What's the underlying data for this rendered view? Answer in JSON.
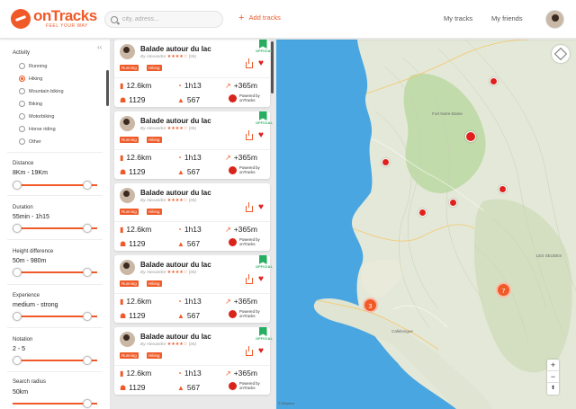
{
  "header": {
    "logo_name": "onTracks",
    "logo_tagline": "FEEL YOUR WAY",
    "search_placeholder": "city, adress...",
    "add_tracks": "Add tracks",
    "my_tracks": "My tracks",
    "my_friends": "My friends"
  },
  "filters": {
    "activity_label": "Activity",
    "activities": [
      {
        "label": "Running",
        "selected": false
      },
      {
        "label": "Hiking",
        "selected": true
      },
      {
        "label": "Mountain biking",
        "selected": false
      },
      {
        "label": "Biking",
        "selected": false
      },
      {
        "label": "Motorbiking",
        "selected": false
      },
      {
        "label": "Horse riding",
        "selected": false
      },
      {
        "label": "Other",
        "selected": false
      }
    ],
    "distance": {
      "label": "Distance",
      "value": "8Km - 19Km"
    },
    "duration": {
      "label": "Duration",
      "value": "55min - 1h15"
    },
    "height": {
      "label": "Height difference",
      "value": "50m - 980m"
    },
    "experience": {
      "label": "Experience",
      "value": "medium - strong"
    },
    "notation": {
      "label": "Notation",
      "value": "2 - 5"
    },
    "radius": {
      "label": "Search radius",
      "value": "50km"
    }
  },
  "tracks": [
    {
      "title": "Balade autour du lac",
      "by": "By Alexandre",
      "stars": "★★★★☆",
      "count": "(36)",
      "tags": [
        "Running",
        "Hiking"
      ],
      "distance": "12.6km",
      "duration": "1h13",
      "elevation": "+365m",
      "views": "1129",
      "likes": "567",
      "powered": "Powered by onTracks",
      "official": "OFFICIAL"
    },
    {
      "title": "Balade autour du lac",
      "by": "By Alexandre",
      "stars": "★★★★☆",
      "count": "(36)",
      "tags": [
        "Running",
        "Hiking"
      ],
      "distance": "12.6km",
      "duration": "1h13",
      "elevation": "+365m",
      "views": "1129",
      "likes": "567",
      "powered": "Powered by onTracks",
      "official": "OFFICIAL"
    },
    {
      "title": "Balade autour du lac",
      "by": "By Alexandre",
      "stars": "★★★★☆",
      "count": "(36)",
      "tags": [
        "Running",
        "Hiking"
      ],
      "distance": "12.6km",
      "duration": "1h13",
      "elevation": "+365m",
      "views": "1129",
      "likes": "567",
      "powered": "Powered by onTracks",
      "official": ""
    },
    {
      "title": "Balade autour du lac",
      "by": "By Alexandre",
      "stars": "★★★★☆",
      "count": "(36)",
      "tags": [
        "Running",
        "Hiking"
      ],
      "distance": "12.6km",
      "duration": "1h13",
      "elevation": "+365m",
      "views": "1129",
      "likes": "567",
      "powered": "Powered by onTracks",
      "official": "OFFICIAL"
    },
    {
      "title": "Balade autour du lac",
      "by": "By Alexandre",
      "stars": "★★★★☆",
      "count": "(36)",
      "tags": [
        "Running",
        "Hiking"
      ],
      "distance": "12.6km",
      "duration": "1h13",
      "elevation": "+365m",
      "views": "1129",
      "likes": "567",
      "powered": "Powered by onTracks",
      "official": "OFFICIAL"
    }
  ],
  "map": {
    "cluster_a": "3",
    "cluster_b": "7",
    "place_1": "Fort Notre-Dame",
    "place_2": "LES SEUDES",
    "place_3": "Callelongue",
    "zoom_in": "+",
    "zoom_out": "−",
    "compass": "⬆",
    "attribution": "© Mapbox"
  },
  "colors": {
    "accent": "#f05a28",
    "like": "#e0201c",
    "official": "#27ae60",
    "sea": "#4aa6e0"
  }
}
